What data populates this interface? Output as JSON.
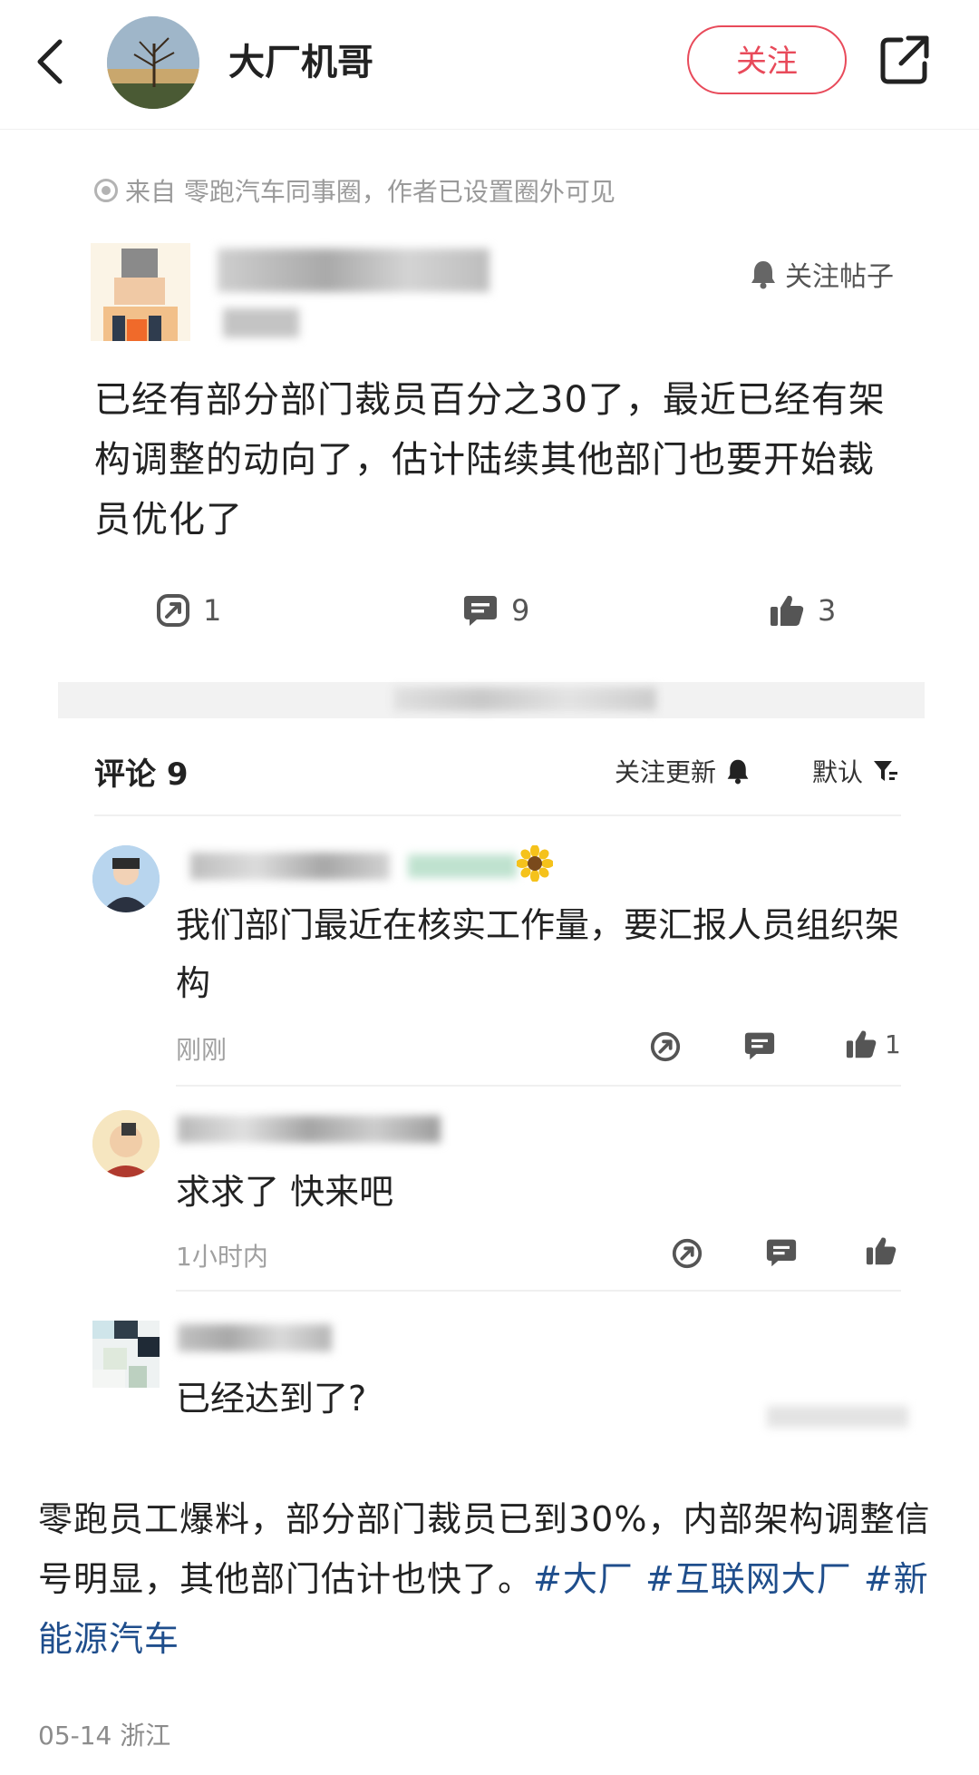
{
  "header": {
    "title": "大厂机哥",
    "follow_label": "关注"
  },
  "post": {
    "source": "来自 零跑汽车同事圈，作者已设置圈外可见",
    "follow_post_label": "关注帖子",
    "text": "已经有部分部门裁员百分之30了，最近已经有架构调整的动向了，估计陆续其他部门也要开始裁员优化了",
    "shares": "1",
    "comments": "9",
    "likes": "3"
  },
  "comments_section": {
    "title": "评论 9",
    "follow_updates_label": "关注更新",
    "sort_label": "默认",
    "comments": [
      {
        "text": "我们部门最近在核实工作量，要汇报人员组织架构",
        "time": "刚刚",
        "likes": "1"
      },
      {
        "text": "求求了 快来吧",
        "time": "1小时内",
        "likes": ""
      },
      {
        "text": "已经达到了?",
        "time": "",
        "likes": ""
      }
    ]
  },
  "caption": {
    "text": "零跑员工爆料，部分部门裁员已到30%，内部架构调整信号明显，其他部门估计也快了。",
    "tags": [
      "#大厂",
      "#互联网大厂",
      "#新能源汽车"
    ]
  },
  "footer": {
    "date": "05-14",
    "location": "浙江"
  },
  "colors": {
    "accent": "#e84a5a",
    "tag": "#1f4e8c"
  }
}
